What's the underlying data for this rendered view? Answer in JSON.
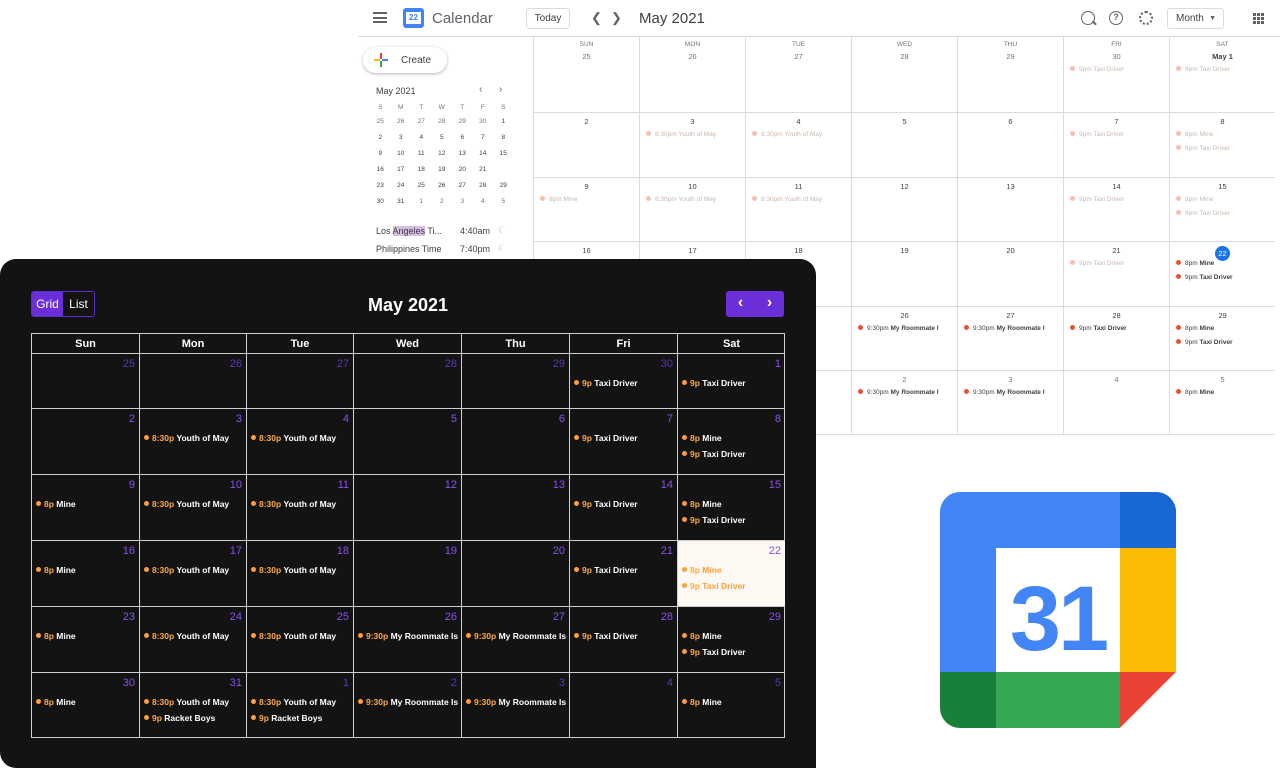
{
  "google_calendar": {
    "app_title": "Calendar",
    "logo_day": "22",
    "today_label": "Today",
    "month_title": "May 2021",
    "view_label": "Month",
    "create_label": "Create",
    "mini_month": "May 2021",
    "mini_headers": [
      "S",
      "M",
      "T",
      "W",
      "T",
      "F",
      "S"
    ],
    "mini_days": [
      "25",
      "26",
      "27",
      "28",
      "29",
      "30",
      "1",
      "2",
      "3",
      "4",
      "5",
      "6",
      "7",
      "8",
      "9",
      "10",
      "11",
      "12",
      "13",
      "14",
      "15",
      "16",
      "17",
      "18",
      "19",
      "20",
      "21",
      "22",
      "23",
      "24",
      "25",
      "26",
      "27",
      "28",
      "29",
      "30",
      "31",
      "1",
      "2",
      "3",
      "4",
      "5"
    ],
    "timezones": [
      {
        "pre": "Los ",
        "highlight": "Angeles",
        "post": " Ti...",
        "time": "4:40am"
      },
      {
        "pre": "Philippines Time",
        "highlight": "",
        "post": "",
        "time": "7:40pm"
      }
    ],
    "weekday_headers": [
      "SUN",
      "MON",
      "TUE",
      "WED",
      "THU",
      "FRI",
      "SAT"
    ],
    "weeks": [
      [
        {
          "d": "25",
          "out": true,
          "ev": []
        },
        {
          "d": "26",
          "out": true,
          "ev": []
        },
        {
          "d": "27",
          "out": true,
          "ev": []
        },
        {
          "d": "28",
          "out": true,
          "ev": []
        },
        {
          "d": "29",
          "out": true,
          "ev": []
        },
        {
          "d": "30",
          "out": true,
          "ev": [
            {
              "t": "9pm",
              "n": "Taxi Driver",
              "s": "past"
            }
          ]
        },
        {
          "d": "May 1",
          "ev": [
            {
              "t": "9pm",
              "n": "Taxi Driver",
              "s": "past"
            }
          ]
        }
      ],
      [
        {
          "d": "2",
          "ev": []
        },
        {
          "d": "3",
          "ev": [
            {
              "t": "8:30pm",
              "n": "Youth of May",
              "s": "past"
            }
          ]
        },
        {
          "d": "4",
          "ev": [
            {
              "t": "8:30pm",
              "n": "Youth of May",
              "s": "past"
            }
          ]
        },
        {
          "d": "5",
          "ev": []
        },
        {
          "d": "6",
          "ev": []
        },
        {
          "d": "7",
          "ev": [
            {
              "t": "9pm",
              "n": "Taxi Driver",
              "s": "past"
            }
          ]
        },
        {
          "d": "8",
          "ev": [
            {
              "t": "8pm",
              "n": "Mine",
              "s": "past"
            },
            {
              "t": "9pm",
              "n": "Taxi Driver",
              "s": "past"
            }
          ]
        }
      ],
      [
        {
          "d": "9",
          "ev": [
            {
              "t": "8pm",
              "n": "Mine",
              "s": "past"
            }
          ]
        },
        {
          "d": "10",
          "ev": [
            {
              "t": "8:30pm",
              "n": "Youth of May",
              "s": "past"
            }
          ]
        },
        {
          "d": "11",
          "ev": [
            {
              "t": "8:30pm",
              "n": "Youth of May",
              "s": "past"
            }
          ]
        },
        {
          "d": "12",
          "ev": []
        },
        {
          "d": "13",
          "ev": []
        },
        {
          "d": "14",
          "ev": [
            {
              "t": "9pm",
              "n": "Taxi Driver",
              "s": "past"
            }
          ]
        },
        {
          "d": "15",
          "ev": [
            {
              "t": "8pm",
              "n": "Mine",
              "s": "past"
            },
            {
              "t": "9pm",
              "n": "Taxi Driver",
              "s": "past"
            }
          ]
        }
      ],
      [
        {
          "d": "16",
          "ev": []
        },
        {
          "d": "17",
          "ev": []
        },
        {
          "d": "18",
          "ev": [
            {
              "t": "",
              "n": "f May",
              "s": "past"
            }
          ]
        },
        {
          "d": "19",
          "ev": []
        },
        {
          "d": "20",
          "ev": []
        },
        {
          "d": "21",
          "ev": [
            {
              "t": "9pm",
              "n": "Taxi Driver",
              "s": "past"
            }
          ]
        },
        {
          "d": "22",
          "cur": true,
          "ev": [
            {
              "t": "8pm",
              "n": "Mine",
              "s": "now"
            },
            {
              "t": "9pm",
              "n": "Taxi Driver",
              "s": "now"
            }
          ]
        }
      ],
      [
        {
          "d": "",
          "ev": []
        },
        {
          "d": "",
          "ev": []
        },
        {
          "d": "",
          "ev": [
            {
              "t": "",
              "n": "of May",
              "s": "now"
            }
          ]
        },
        {
          "d": "26",
          "ev": [
            {
              "t": "9:30pm",
              "n": "My Roommate I",
              "s": "now"
            }
          ]
        },
        {
          "d": "27",
          "ev": [
            {
              "t": "9:30pm",
              "n": "My Roommate I",
              "s": "now"
            }
          ]
        },
        {
          "d": "28",
          "ev": [
            {
              "t": "9pm",
              "n": "Taxi Driver",
              "s": "now"
            }
          ]
        },
        {
          "d": "29",
          "ev": [
            {
              "t": "8pm",
              "n": "Mine",
              "s": "now"
            },
            {
              "t": "9pm",
              "n": "Taxi Driver",
              "s": "now"
            }
          ]
        }
      ],
      [
        {
          "d": "",
          "ev": []
        },
        {
          "d": "",
          "ev": []
        },
        {
          "d": "",
          "ev": [
            {
              "t": "",
              "n": "of May",
              "s": "now"
            },
            {
              "t": "",
              "n": "ys",
              "s": "now"
            }
          ]
        },
        {
          "d": "2",
          "out": true,
          "ev": [
            {
              "t": "9:30pm",
              "n": "My Roommate I",
              "s": "now"
            }
          ]
        },
        {
          "d": "3",
          "out": true,
          "ev": [
            {
              "t": "9:30pm",
              "n": "My Roommate I",
              "s": "now"
            }
          ]
        },
        {
          "d": "4",
          "out": true,
          "ev": []
        },
        {
          "d": "5",
          "out": true,
          "ev": [
            {
              "t": "8pm",
              "n": "Mine",
              "s": "now"
            }
          ]
        }
      ]
    ]
  },
  "dark_widget": {
    "toggle": [
      "Grid",
      "List"
    ],
    "active_view": "Grid",
    "title": "May 2021",
    "nav_prev": "‹",
    "nav_next": "›",
    "headers": [
      "Sun",
      "Mon",
      "Tue",
      "Wed",
      "Thu",
      "Fri",
      "Sat"
    ],
    "weeks": [
      [
        {
          "d": "25",
          "out": true,
          "ev": []
        },
        {
          "d": "26",
          "out": true,
          "ev": []
        },
        {
          "d": "27",
          "out": true,
          "ev": []
        },
        {
          "d": "28",
          "out": true,
          "ev": []
        },
        {
          "d": "29",
          "out": true,
          "ev": []
        },
        {
          "d": "30",
          "out": true,
          "ev": [
            {
              "t": "9p",
              "n": "Taxi Driver"
            }
          ]
        },
        {
          "d": "1",
          "ev": [
            {
              "t": "9p",
              "n": "Taxi Driver"
            }
          ]
        }
      ],
      [
        {
          "d": "2",
          "ev": []
        },
        {
          "d": "3",
          "ev": [
            {
              "t": "8:30p",
              "n": "Youth of May"
            }
          ]
        },
        {
          "d": "4",
          "ev": [
            {
              "t": "8:30p",
              "n": "Youth of May"
            }
          ]
        },
        {
          "d": "5",
          "ev": []
        },
        {
          "d": "6",
          "ev": []
        },
        {
          "d": "7",
          "ev": [
            {
              "t": "9p",
              "n": "Taxi Driver"
            }
          ]
        },
        {
          "d": "8",
          "ev": [
            {
              "t": "8p",
              "n": "Mine"
            },
            {
              "t": "9p",
              "n": "Taxi Driver"
            }
          ]
        }
      ],
      [
        {
          "d": "9",
          "ev": [
            {
              "t": "8p",
              "n": "Mine"
            }
          ]
        },
        {
          "d": "10",
          "ev": [
            {
              "t": "8:30p",
              "n": "Youth of May"
            }
          ]
        },
        {
          "d": "11",
          "ev": [
            {
              "t": "8:30p",
              "n": "Youth of May"
            }
          ]
        },
        {
          "d": "12",
          "ev": []
        },
        {
          "d": "13",
          "ev": []
        },
        {
          "d": "14",
          "ev": [
            {
              "t": "9p",
              "n": "Taxi Driver"
            }
          ]
        },
        {
          "d": "15",
          "ev": [
            {
              "t": "8p",
              "n": "Mine"
            },
            {
              "t": "9p",
              "n": "Taxi Driver"
            }
          ]
        }
      ],
      [
        {
          "d": "16",
          "ev": [
            {
              "t": "8p",
              "n": "Mine"
            }
          ]
        },
        {
          "d": "17",
          "ev": [
            {
              "t": "8:30p",
              "n": "Youth of May"
            }
          ]
        },
        {
          "d": "18",
          "ev": [
            {
              "t": "8:30p",
              "n": "Youth of May"
            }
          ]
        },
        {
          "d": "19",
          "ev": []
        },
        {
          "d": "20",
          "ev": []
        },
        {
          "d": "21",
          "ev": [
            {
              "t": "9p",
              "n": "Taxi Driver"
            }
          ]
        },
        {
          "d": "22",
          "today": true,
          "ev": [
            {
              "t": "8p",
              "n": "Mine"
            },
            {
              "t": "9p",
              "n": "Taxi Driver"
            }
          ]
        }
      ],
      [
        {
          "d": "23",
          "ev": [
            {
              "t": "8p",
              "n": "Mine"
            }
          ]
        },
        {
          "d": "24",
          "ev": [
            {
              "t": "8:30p",
              "n": "Youth of May"
            }
          ]
        },
        {
          "d": "25",
          "ev": [
            {
              "t": "8:30p",
              "n": "Youth of May"
            }
          ]
        },
        {
          "d": "26",
          "ev": [
            {
              "t": "9:30p",
              "n": "My Roommate Is a"
            }
          ]
        },
        {
          "d": "27",
          "ev": [
            {
              "t": "9:30p",
              "n": "My Roommate Is a"
            }
          ]
        },
        {
          "d": "28",
          "ev": [
            {
              "t": "9p",
              "n": "Taxi Driver"
            }
          ]
        },
        {
          "d": "29",
          "ev": [
            {
              "t": "8p",
              "n": "Mine"
            },
            {
              "t": "9p",
              "n": "Taxi Driver"
            }
          ]
        }
      ],
      [
        {
          "d": "30",
          "ev": [
            {
              "t": "8p",
              "n": "Mine"
            }
          ]
        },
        {
          "d": "31",
          "ev": [
            {
              "t": "8:30p",
              "n": "Youth of May"
            },
            {
              "t": "9p",
              "n": "Racket Boys"
            }
          ]
        },
        {
          "d": "1",
          "out": true,
          "ev": [
            {
              "t": "8:30p",
              "n": "Youth of May"
            },
            {
              "t": "9p",
              "n": "Racket Boys"
            }
          ]
        },
        {
          "d": "2",
          "out": true,
          "ev": [
            {
              "t": "9:30p",
              "n": "My Roommate Is a"
            }
          ]
        },
        {
          "d": "3",
          "out": true,
          "ev": [
            {
              "t": "9:30p",
              "n": "My Roommate Is a"
            }
          ]
        },
        {
          "d": "4",
          "out": true,
          "ev": []
        },
        {
          "d": "5",
          "out": true,
          "ev": [
            {
              "t": "8p",
              "n": "Mine"
            }
          ]
        }
      ]
    ]
  },
  "big_logo": {
    "day": "31"
  },
  "colors": {
    "accent_purple": "#6a2fd8",
    "event_orange": "#ff9d3b",
    "google_blue": "#4285f4",
    "google_red": "#ea4335",
    "google_yellow": "#fbbc04",
    "google_green": "#34a853"
  }
}
